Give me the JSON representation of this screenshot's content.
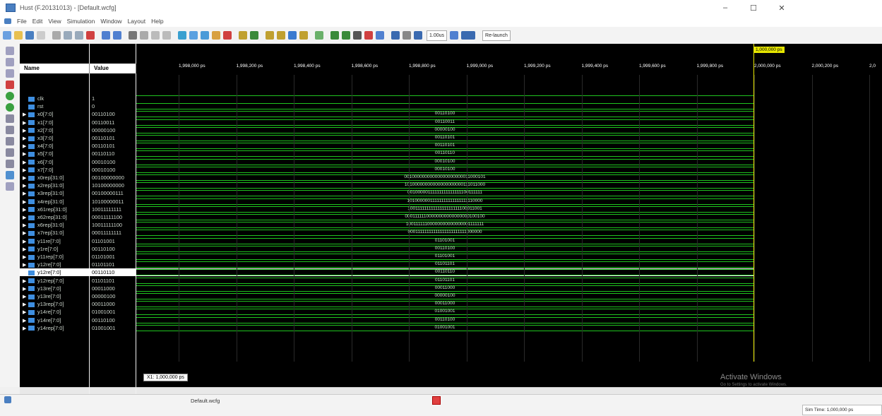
{
  "window": {
    "title": "Hust (F.20131013) - [Default.wcfg]",
    "controls": [
      "–",
      "☐",
      "✕"
    ]
  },
  "menu": [
    "File",
    "Edit",
    "View",
    "Simulation",
    "Window",
    "Layout",
    "Help"
  ],
  "toolbar": {
    "time_value": "1.00us",
    "relaunch_label": "Re-launch"
  },
  "columns": {
    "name": "Name",
    "value": "Value"
  },
  "signals": [
    {
      "name": "clk",
      "value": "1",
      "expandable": false,
      "wave": ""
    },
    {
      "name": "rst",
      "value": "0",
      "expandable": false,
      "wave": ""
    },
    {
      "name": "x0[7:0]",
      "value": "00110100",
      "expandable": true,
      "wave": "00110100"
    },
    {
      "name": "x1[7:0]",
      "value": "00110011",
      "expandable": true,
      "wave": "00110011"
    },
    {
      "name": "x2[7:0]",
      "value": "00000100",
      "expandable": true,
      "wave": "00000100"
    },
    {
      "name": "x3[7:0]",
      "value": "00110101",
      "expandable": true,
      "wave": "00110101"
    },
    {
      "name": "x4[7:0]",
      "value": "00110101",
      "expandable": true,
      "wave": "00110101"
    },
    {
      "name": "x5[7:0]",
      "value": "00110110",
      "expandable": true,
      "wave": "00110110"
    },
    {
      "name": "x6[7:0]",
      "value": "00010100",
      "expandable": true,
      "wave": "00010100"
    },
    {
      "name": "x7[7:0]",
      "value": "00010100",
      "expandable": true,
      "wave": "00010100"
    },
    {
      "name": "x0rep[31:0]",
      "value": "00100000000",
      "expandable": true,
      "wave": "00100000000000000000000011000101"
    },
    {
      "name": "x2rep[31:0]",
      "value": "10100000000",
      "expandable": true,
      "wave": "10100000000000000000000111011000"
    },
    {
      "name": "x3rep[31:0]",
      "value": "00100000111",
      "expandable": true,
      "wave": "00100000111111111111111100111111"
    },
    {
      "name": "x4rep[31:0]",
      "value": "10100000011",
      "expandable": true,
      "wave": "10100000011111111111111111110000"
    },
    {
      "name": "x61rep[31:0]",
      "value": "10011111111",
      "expandable": true,
      "wave": "10011111111111111111111100011001"
    },
    {
      "name": "x62rep[31:0]",
      "value": "00011111100",
      "expandable": true,
      "wave": "00011111100000000000000000100100"
    },
    {
      "name": "x6rep[31:0]",
      "value": "10011111100",
      "expandable": true,
      "wave": "10011111100000000000000001111111"
    },
    {
      "name": "x7rep[31:0]",
      "value": "00011111111",
      "expandable": true,
      "wave": "00011111111111111111111111000000"
    },
    {
      "name": "y11re[7:0]",
      "value": "01101001",
      "expandable": true,
      "wave": "01101001"
    },
    {
      "name": "y1re[7:0]",
      "value": "00110100",
      "expandable": true,
      "wave": "00110100"
    },
    {
      "name": "y11rep[7:0]",
      "value": "01101001",
      "expandable": true,
      "wave": "01101001"
    },
    {
      "name": "y12re[7:0]",
      "value": "01101101",
      "expandable": true,
      "wave": "01101101"
    },
    {
      "name": "y12re[7:0]",
      "value": "00110110",
      "expandable": true,
      "wave": "00110110",
      "selected": true
    },
    {
      "name": "y12rep[7:0]",
      "value": "01101101",
      "expandable": true,
      "wave": "01101101"
    },
    {
      "name": "y13re[7:0]",
      "value": "00011000",
      "expandable": true,
      "wave": "00011000"
    },
    {
      "name": "y13re[7:0]",
      "value": "00000100",
      "expandable": true,
      "wave": "00000100"
    },
    {
      "name": "y13rep[7:0]",
      "value": "00011000",
      "expandable": true,
      "wave": "00011000"
    },
    {
      "name": "y14re[7:0]",
      "value": "01001001",
      "expandable": true,
      "wave": "01001001"
    },
    {
      "name": "y14re[7:0]",
      "value": "00110100",
      "expandable": true,
      "wave": "00110100"
    },
    {
      "name": "y14rep[7:0]",
      "value": "01001001",
      "expandable": true,
      "wave": "01001001"
    }
  ],
  "ruler": {
    "cursor_label": "1,000,000 ps",
    "ticks": [
      "1,998,000 ps",
      "1,998,200 ps",
      "1,998,400 ps",
      "1,998,600 ps",
      "1,998,800 ps",
      "1,999,000 ps",
      "1,999,200 ps",
      "1,999,400 ps",
      "1,999,600 ps",
      "1,999,800 ps",
      "2,000,000 ps",
      "2,000,200 ps",
      "2,0"
    ]
  },
  "marker_label": "X1: 1,000,000 ps",
  "document_tab": "Default.wcfg",
  "status": {
    "sim_time": "Sim Time: 1,000,000 ps"
  },
  "watermark": {
    "title": "Activate Windows",
    "subtitle": "Go to Settings to activate Windows."
  },
  "colors": {
    "wave": "#1fc41f",
    "cursor": "#e6e600",
    "background": "#000000"
  }
}
